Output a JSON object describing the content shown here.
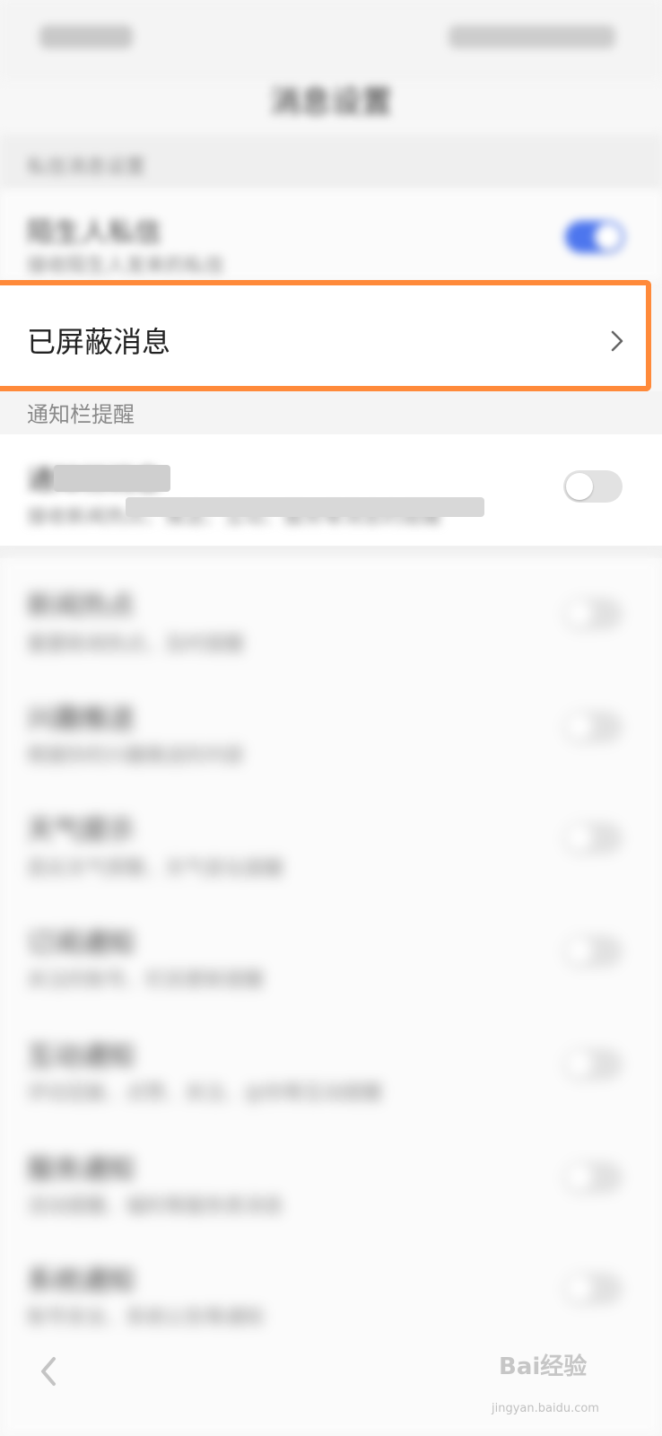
{
  "page_title": "消息设置",
  "section_label": "私信消息设置",
  "setting_top": {
    "title": "陌生人私信",
    "subtitle": "接收陌生人发来的私信",
    "toggle_on": true
  },
  "blocked_messages": {
    "label": "已屏蔽消息"
  },
  "notify_section": {
    "label": "通知栏提醒"
  },
  "notify_master": {
    "title": "通知栏消息",
    "subtitle": "接收新闻热点、推送、互动、服务等消息的提醒",
    "toggle_on": false
  },
  "items": [
    {
      "title": "新闻热点",
      "subtitle": "重要新闻热点，及时提醒"
    },
    {
      "title": "兴趣推送",
      "subtitle": "根据你的兴趣推送的内容"
    },
    {
      "title": "天气提示",
      "subtitle": "恶劣天气预警，天气变化提醒"
    },
    {
      "title": "订阅通知",
      "subtitle": "关注的账号、栏目更新提醒"
    },
    {
      "title": "互动通知",
      "subtitle": "评论回复、点赞、关注、@你等互动提醒"
    },
    {
      "title": "服务通知",
      "subtitle": "活动提醒、福利等服务类消息"
    },
    {
      "title": "系统通知",
      "subtitle": "账号安全、系统公告等通知"
    }
  ],
  "watermark": {
    "text": "Bai经验",
    "sub": "jingyan.baidu.com"
  },
  "colors": {
    "highlight": "#ff8a3a",
    "toggle_on": "#4d76ee"
  }
}
